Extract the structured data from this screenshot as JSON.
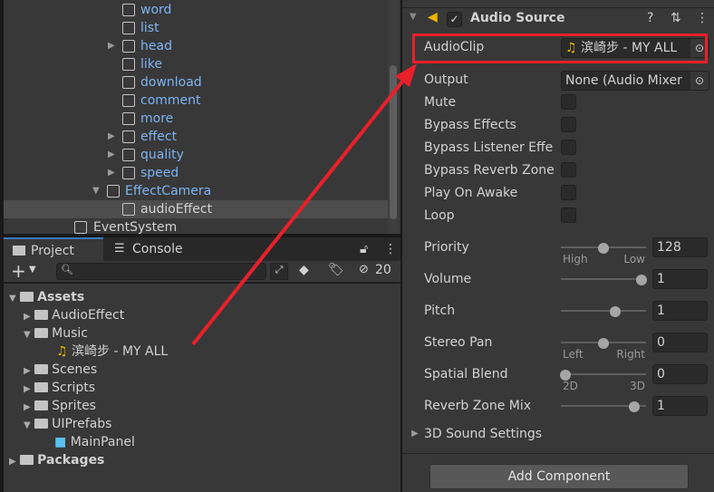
{
  "hierarchy": {
    "items": [
      {
        "label": "word",
        "expandable": false
      },
      {
        "label": "list",
        "expandable": false
      },
      {
        "label": "head",
        "expandable": true
      },
      {
        "label": "like",
        "expandable": false
      },
      {
        "label": "download",
        "expandable": false
      },
      {
        "label": "comment",
        "expandable": false
      },
      {
        "label": "more",
        "expandable": false
      },
      {
        "label": "effect",
        "expandable": true
      },
      {
        "label": "quality",
        "expandable": true
      },
      {
        "label": "speed",
        "expandable": true
      },
      {
        "label": "EffectCamera",
        "expandable": true
      },
      {
        "label": "audioEffect",
        "selected": true
      },
      {
        "label": "EventSystem"
      }
    ]
  },
  "tabs": {
    "project": "Project",
    "console": "Console"
  },
  "toolbar": {
    "hidden_count": "20",
    "search_placeholder": ""
  },
  "project": {
    "assets": "Assets",
    "audio_effect": "AudioEffect",
    "music": "Music",
    "music_file": "滨崎步 - MY ALL",
    "scenes": "Scenes",
    "scripts": "Scripts",
    "sprites": "Sprites",
    "uiprefabs": "UIPrefabs",
    "main_panel": "MainPanel",
    "packages": "Packages"
  },
  "inspector": {
    "component_title": "Audio Source",
    "enabled": true,
    "audio_clip_label": "AudioClip",
    "audio_clip_value": "滨崎步 - MY ALL",
    "output_label": "Output",
    "output_value": "None (Audio Mixer",
    "checkboxes": [
      {
        "label": "Mute",
        "checked": false
      },
      {
        "label": "Bypass Effects",
        "checked": false
      },
      {
        "label": "Bypass Listener Effe",
        "checked": false
      },
      {
        "label": "Bypass Reverb Zone",
        "checked": false
      },
      {
        "label": "Play On Awake",
        "checked": false
      },
      {
        "label": "Loop",
        "checked": false
      }
    ],
    "sliders": [
      {
        "label": "Priority",
        "value": "128",
        "fraction": 0.5,
        "min_label": "High",
        "max_label": "Low"
      },
      {
        "label": "Volume",
        "value": "1",
        "fraction": 1.0,
        "min_label": "",
        "max_label": ""
      },
      {
        "label": "Pitch",
        "value": "1",
        "fraction": 0.66,
        "min_label": "",
        "max_label": ""
      },
      {
        "label": "Stereo Pan",
        "value": "0",
        "fraction": 0.5,
        "min_label": "Left",
        "max_label": "Right"
      },
      {
        "label": "Spatial Blend",
        "value": "0",
        "fraction": 0.0,
        "min_label": "2D",
        "max_label": "3D"
      },
      {
        "label": "Reverb Zone Mix",
        "value": "1",
        "fraction": 0.9,
        "min_label": "",
        "max_label": ""
      }
    ],
    "sound_settings": "3D Sound Settings",
    "add_component": "Add Component"
  },
  "annotation_color": "#e8202a"
}
